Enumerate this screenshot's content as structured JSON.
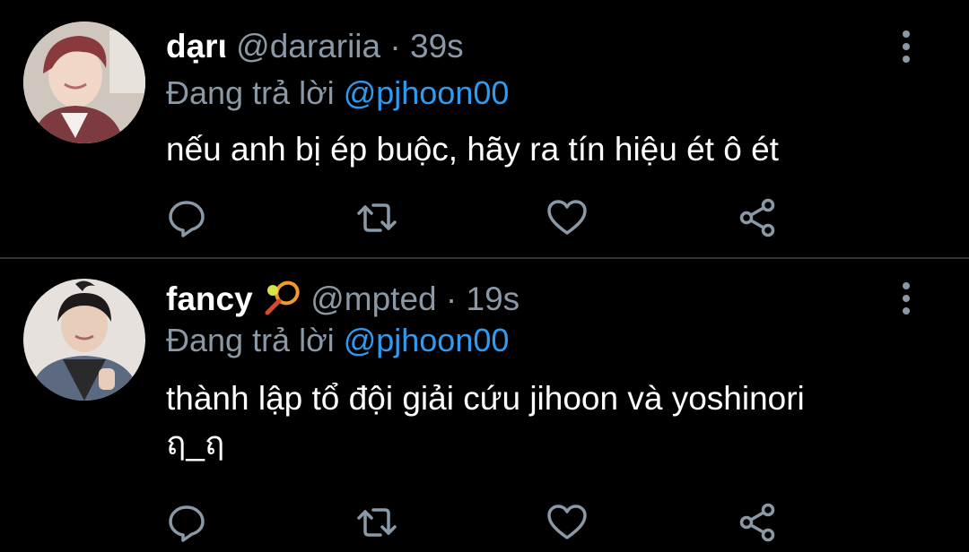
{
  "colors": {
    "background": "#000000",
    "divider": "#2f3336",
    "secondary_text": "#8b98a5",
    "mention": "#2f9bf0",
    "primary_text": "#ffffff"
  },
  "tweets": [
    {
      "name": "dạrι",
      "handle": "@darariia",
      "separator": "·",
      "time": "39s",
      "reply_prefix": "Đang trả lời",
      "reply_to": "@pjhoon00",
      "text_lines": [
        "nếu anh bị ép buộc, hãy ra tín hiệu ét ô ét"
      ],
      "icons": [
        "reply-icon",
        "retweet-icon",
        "like-icon",
        "share-icon",
        "more-icon"
      ]
    },
    {
      "name": "fancy",
      "name_emoji": "tennis-racket-icon",
      "handle": "@mpted",
      "separator": "·",
      "time": "19s",
      "reply_prefix": "Đang trả lời",
      "reply_to": "@pjhoon00",
      "text_lines": [
        "thành lập tổ đội giải cứu jihoon và yoshinori",
        "ฤ_ฤ"
      ],
      "icons": [
        "reply-icon",
        "retweet-icon",
        "like-icon",
        "share-icon",
        "more-icon"
      ]
    }
  ]
}
